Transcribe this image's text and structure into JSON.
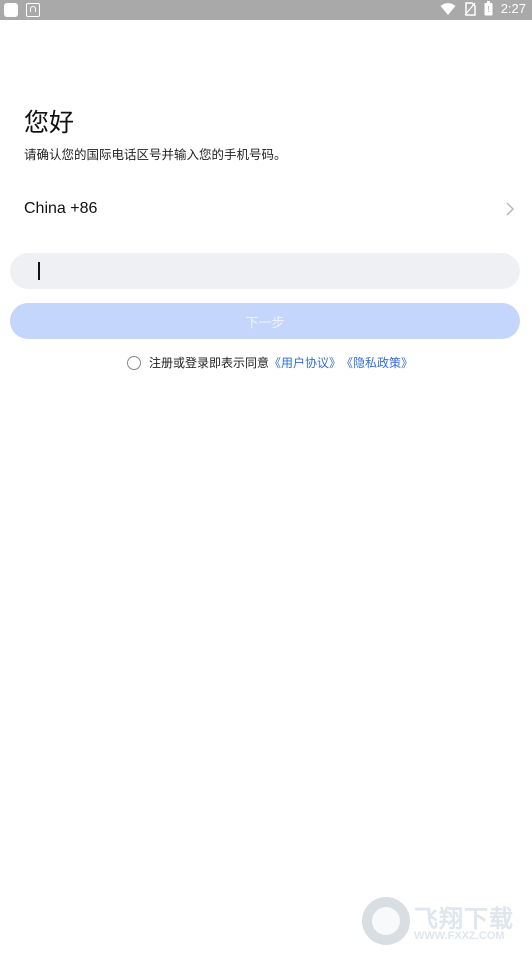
{
  "status_bar": {
    "time": "2:27"
  },
  "header": {
    "title": "您好",
    "subtitle": "请确认您的国际电话区号并输入您的手机号码。"
  },
  "country": {
    "label": "China +86"
  },
  "phone": {
    "value": ""
  },
  "next_button": {
    "label": "下一步"
  },
  "agreement": {
    "prefix": "注册或登录即表示同意",
    "user_agreement": "《用户协议》",
    "privacy_policy": "《隐私政策》"
  },
  "watermark": {
    "brand": "飞翔下载",
    "url": "WWW.FXXZ.COM"
  }
}
